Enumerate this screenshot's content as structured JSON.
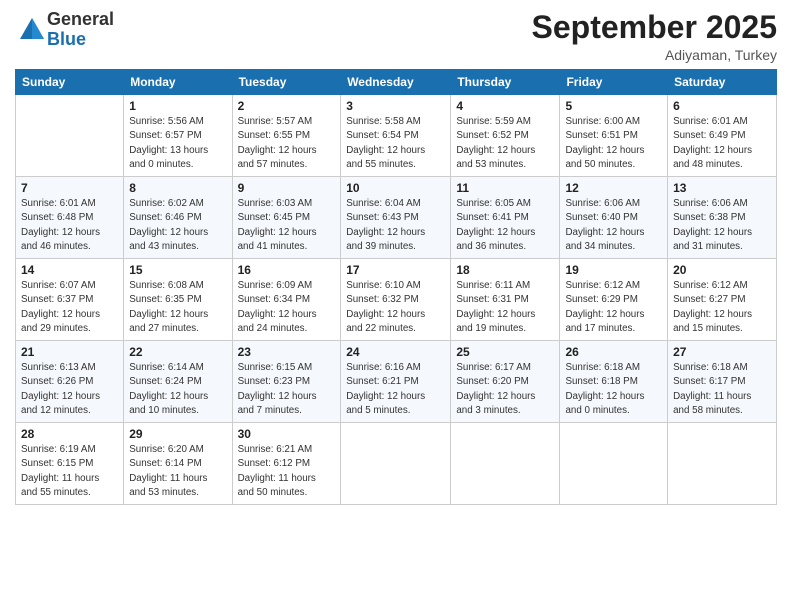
{
  "logo": {
    "general": "General",
    "blue": "Blue"
  },
  "header": {
    "month": "September 2025",
    "location": "Adiyaman, Turkey"
  },
  "weekdays": [
    "Sunday",
    "Monday",
    "Tuesday",
    "Wednesday",
    "Thursday",
    "Friday",
    "Saturday"
  ],
  "weeks": [
    [
      {
        "day": "",
        "info": ""
      },
      {
        "day": "1",
        "info": "Sunrise: 5:56 AM\nSunset: 6:57 PM\nDaylight: 13 hours\nand 0 minutes."
      },
      {
        "day": "2",
        "info": "Sunrise: 5:57 AM\nSunset: 6:55 PM\nDaylight: 12 hours\nand 57 minutes."
      },
      {
        "day": "3",
        "info": "Sunrise: 5:58 AM\nSunset: 6:54 PM\nDaylight: 12 hours\nand 55 minutes."
      },
      {
        "day": "4",
        "info": "Sunrise: 5:59 AM\nSunset: 6:52 PM\nDaylight: 12 hours\nand 53 minutes."
      },
      {
        "day": "5",
        "info": "Sunrise: 6:00 AM\nSunset: 6:51 PM\nDaylight: 12 hours\nand 50 minutes."
      },
      {
        "day": "6",
        "info": "Sunrise: 6:01 AM\nSunset: 6:49 PM\nDaylight: 12 hours\nand 48 minutes."
      }
    ],
    [
      {
        "day": "7",
        "info": "Sunrise: 6:01 AM\nSunset: 6:48 PM\nDaylight: 12 hours\nand 46 minutes."
      },
      {
        "day": "8",
        "info": "Sunrise: 6:02 AM\nSunset: 6:46 PM\nDaylight: 12 hours\nand 43 minutes."
      },
      {
        "day": "9",
        "info": "Sunrise: 6:03 AM\nSunset: 6:45 PM\nDaylight: 12 hours\nand 41 minutes."
      },
      {
        "day": "10",
        "info": "Sunrise: 6:04 AM\nSunset: 6:43 PM\nDaylight: 12 hours\nand 39 minutes."
      },
      {
        "day": "11",
        "info": "Sunrise: 6:05 AM\nSunset: 6:41 PM\nDaylight: 12 hours\nand 36 minutes."
      },
      {
        "day": "12",
        "info": "Sunrise: 6:06 AM\nSunset: 6:40 PM\nDaylight: 12 hours\nand 34 minutes."
      },
      {
        "day": "13",
        "info": "Sunrise: 6:06 AM\nSunset: 6:38 PM\nDaylight: 12 hours\nand 31 minutes."
      }
    ],
    [
      {
        "day": "14",
        "info": "Sunrise: 6:07 AM\nSunset: 6:37 PM\nDaylight: 12 hours\nand 29 minutes."
      },
      {
        "day": "15",
        "info": "Sunrise: 6:08 AM\nSunset: 6:35 PM\nDaylight: 12 hours\nand 27 minutes."
      },
      {
        "day": "16",
        "info": "Sunrise: 6:09 AM\nSunset: 6:34 PM\nDaylight: 12 hours\nand 24 minutes."
      },
      {
        "day": "17",
        "info": "Sunrise: 6:10 AM\nSunset: 6:32 PM\nDaylight: 12 hours\nand 22 minutes."
      },
      {
        "day": "18",
        "info": "Sunrise: 6:11 AM\nSunset: 6:31 PM\nDaylight: 12 hours\nand 19 minutes."
      },
      {
        "day": "19",
        "info": "Sunrise: 6:12 AM\nSunset: 6:29 PM\nDaylight: 12 hours\nand 17 minutes."
      },
      {
        "day": "20",
        "info": "Sunrise: 6:12 AM\nSunset: 6:27 PM\nDaylight: 12 hours\nand 15 minutes."
      }
    ],
    [
      {
        "day": "21",
        "info": "Sunrise: 6:13 AM\nSunset: 6:26 PM\nDaylight: 12 hours\nand 12 minutes."
      },
      {
        "day": "22",
        "info": "Sunrise: 6:14 AM\nSunset: 6:24 PM\nDaylight: 12 hours\nand 10 minutes."
      },
      {
        "day": "23",
        "info": "Sunrise: 6:15 AM\nSunset: 6:23 PM\nDaylight: 12 hours\nand 7 minutes."
      },
      {
        "day": "24",
        "info": "Sunrise: 6:16 AM\nSunset: 6:21 PM\nDaylight: 12 hours\nand 5 minutes."
      },
      {
        "day": "25",
        "info": "Sunrise: 6:17 AM\nSunset: 6:20 PM\nDaylight: 12 hours\nand 3 minutes."
      },
      {
        "day": "26",
        "info": "Sunrise: 6:18 AM\nSunset: 6:18 PM\nDaylight: 12 hours\nand 0 minutes."
      },
      {
        "day": "27",
        "info": "Sunrise: 6:18 AM\nSunset: 6:17 PM\nDaylight: 11 hours\nand 58 minutes."
      }
    ],
    [
      {
        "day": "28",
        "info": "Sunrise: 6:19 AM\nSunset: 6:15 PM\nDaylight: 11 hours\nand 55 minutes."
      },
      {
        "day": "29",
        "info": "Sunrise: 6:20 AM\nSunset: 6:14 PM\nDaylight: 11 hours\nand 53 minutes."
      },
      {
        "day": "30",
        "info": "Sunrise: 6:21 AM\nSunset: 6:12 PM\nDaylight: 11 hours\nand 50 minutes."
      },
      {
        "day": "",
        "info": ""
      },
      {
        "day": "",
        "info": ""
      },
      {
        "day": "",
        "info": ""
      },
      {
        "day": "",
        "info": ""
      }
    ]
  ]
}
